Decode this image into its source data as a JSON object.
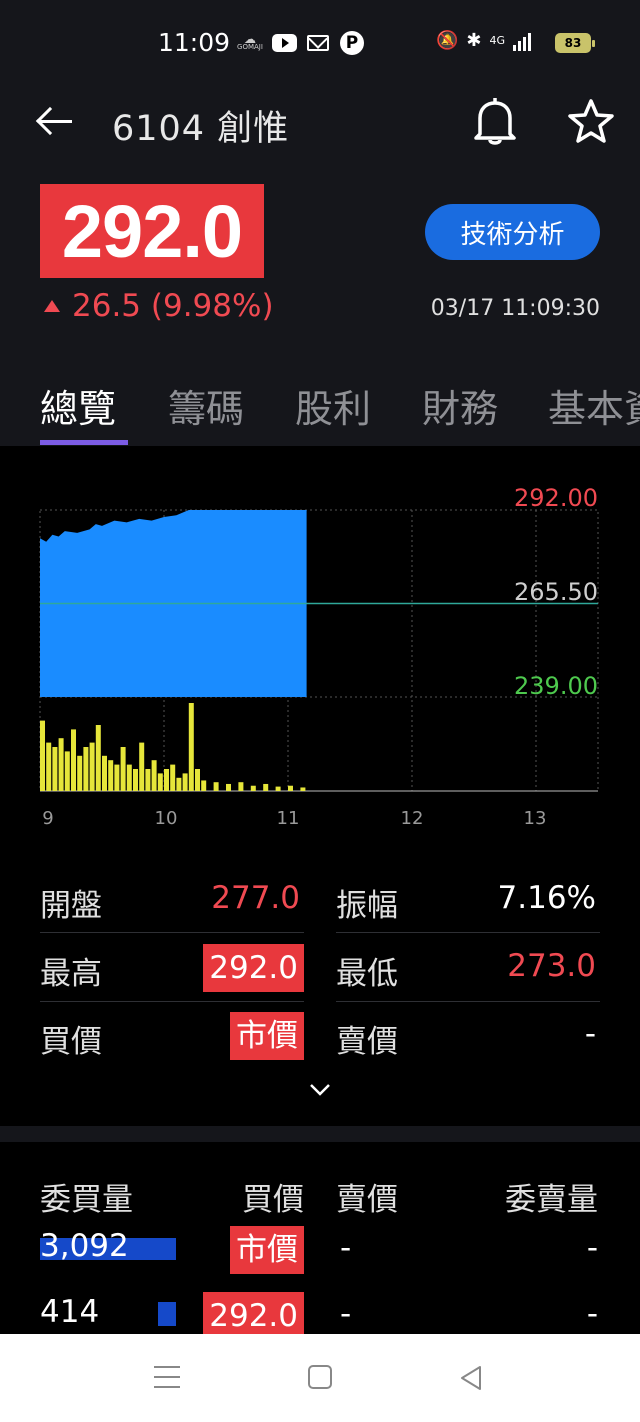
{
  "status_bar": {
    "time": "11:09",
    "gomaji_label": "GOMAJI",
    "p_label": "P",
    "network": "4G",
    "battery": "83"
  },
  "header": {
    "title": "6104 創惟",
    "price": "292.0",
    "tech_button": "技術分析",
    "change": "26.5 (9.98%)",
    "timestamp": "03/17 11:09:30"
  },
  "tabs": [
    "總覽",
    "籌碼",
    "股利",
    "財務",
    "基本資料"
  ],
  "chart_data": {
    "type": "area",
    "price_labels": [
      "292.00",
      "265.50",
      "239.00"
    ],
    "ylim": [
      239.0,
      292.0
    ],
    "reference": 265.5,
    "x_ticks": [
      "9",
      "10",
      "11",
      "12",
      "13"
    ],
    "price_series": [
      {
        "t": 9.0,
        "v": 284.0
      },
      {
        "t": 9.05,
        "v": 283.0
      },
      {
        "t": 9.1,
        "v": 285.0
      },
      {
        "t": 9.15,
        "v": 284.5
      },
      {
        "t": 9.2,
        "v": 286.0
      },
      {
        "t": 9.3,
        "v": 285.5
      },
      {
        "t": 9.4,
        "v": 286.5
      },
      {
        "t": 9.45,
        "v": 288.0
      },
      {
        "t": 9.5,
        "v": 287.5
      },
      {
        "t": 9.6,
        "v": 289.0
      },
      {
        "t": 9.7,
        "v": 288.5
      },
      {
        "t": 9.8,
        "v": 289.5
      },
      {
        "t": 9.9,
        "v": 289.0
      },
      {
        "t": 10.0,
        "v": 290.0
      },
      {
        "t": 10.1,
        "v": 290.5
      },
      {
        "t": 10.2,
        "v": 292.0
      },
      {
        "t": 10.5,
        "v": 292.0
      },
      {
        "t": 11.0,
        "v": 292.0
      },
      {
        "t": 11.15,
        "v": 292.0
      }
    ],
    "volume_series": [
      {
        "t": 9.0,
        "v": 0.8
      },
      {
        "t": 9.05,
        "v": 0.55
      },
      {
        "t": 9.1,
        "v": 0.5
      },
      {
        "t": 9.15,
        "v": 0.6
      },
      {
        "t": 9.2,
        "v": 0.45
      },
      {
        "t": 9.25,
        "v": 0.7
      },
      {
        "t": 9.3,
        "v": 0.4
      },
      {
        "t": 9.35,
        "v": 0.5
      },
      {
        "t": 9.4,
        "v": 0.55
      },
      {
        "t": 9.45,
        "v": 0.75
      },
      {
        "t": 9.5,
        "v": 0.4
      },
      {
        "t": 9.55,
        "v": 0.35
      },
      {
        "t": 9.6,
        "v": 0.3
      },
      {
        "t": 9.65,
        "v": 0.5
      },
      {
        "t": 9.7,
        "v": 0.3
      },
      {
        "t": 9.75,
        "v": 0.25
      },
      {
        "t": 9.8,
        "v": 0.55
      },
      {
        "t": 9.85,
        "v": 0.25
      },
      {
        "t": 9.9,
        "v": 0.35
      },
      {
        "t": 9.95,
        "v": 0.2
      },
      {
        "t": 10.0,
        "v": 0.25
      },
      {
        "t": 10.05,
        "v": 0.3
      },
      {
        "t": 10.1,
        "v": 0.15
      },
      {
        "t": 10.15,
        "v": 0.2
      },
      {
        "t": 10.2,
        "v": 1.0
      },
      {
        "t": 10.25,
        "v": 0.25
      },
      {
        "t": 10.3,
        "v": 0.12
      },
      {
        "t": 10.4,
        "v": 0.1
      },
      {
        "t": 10.5,
        "v": 0.08
      },
      {
        "t": 10.6,
        "v": 0.1
      },
      {
        "t": 10.7,
        "v": 0.06
      },
      {
        "t": 10.8,
        "v": 0.08
      },
      {
        "t": 10.9,
        "v": 0.05
      },
      {
        "t": 11.0,
        "v": 0.06
      },
      {
        "t": 11.1,
        "v": 0.04
      }
    ]
  },
  "stats": {
    "open_label": "開盤",
    "open_value": "277.0",
    "amplitude_label": "振幅",
    "amplitude_value": "7.16%",
    "high_label": "最高",
    "high_value": "292.0",
    "low_label": "最低",
    "low_value": "273.0",
    "bid_label": "買價",
    "bid_value": "市價",
    "ask_label": "賣價",
    "ask_value": "-"
  },
  "order_book": {
    "headers": [
      "委買量",
      "買價",
      "賣價",
      "委賣量"
    ],
    "rows": [
      {
        "bid_qty": "3,092",
        "bid_price": "市價",
        "ask_price": "-",
        "ask_qty": "-",
        "bar_fraction": 1.0
      },
      {
        "bid_qty": "414",
        "bid_price": "292.0",
        "ask_price": "-",
        "ask_qty": "-",
        "bar_fraction": 0.13
      }
    ]
  },
  "colors": {
    "up_red": "#e8383d",
    "area_blue": "#1a8cff",
    "volume_yellow": "#e6e63a",
    "accent_purple": "#7c5ce4",
    "button_blue": "#1a6ce0"
  }
}
